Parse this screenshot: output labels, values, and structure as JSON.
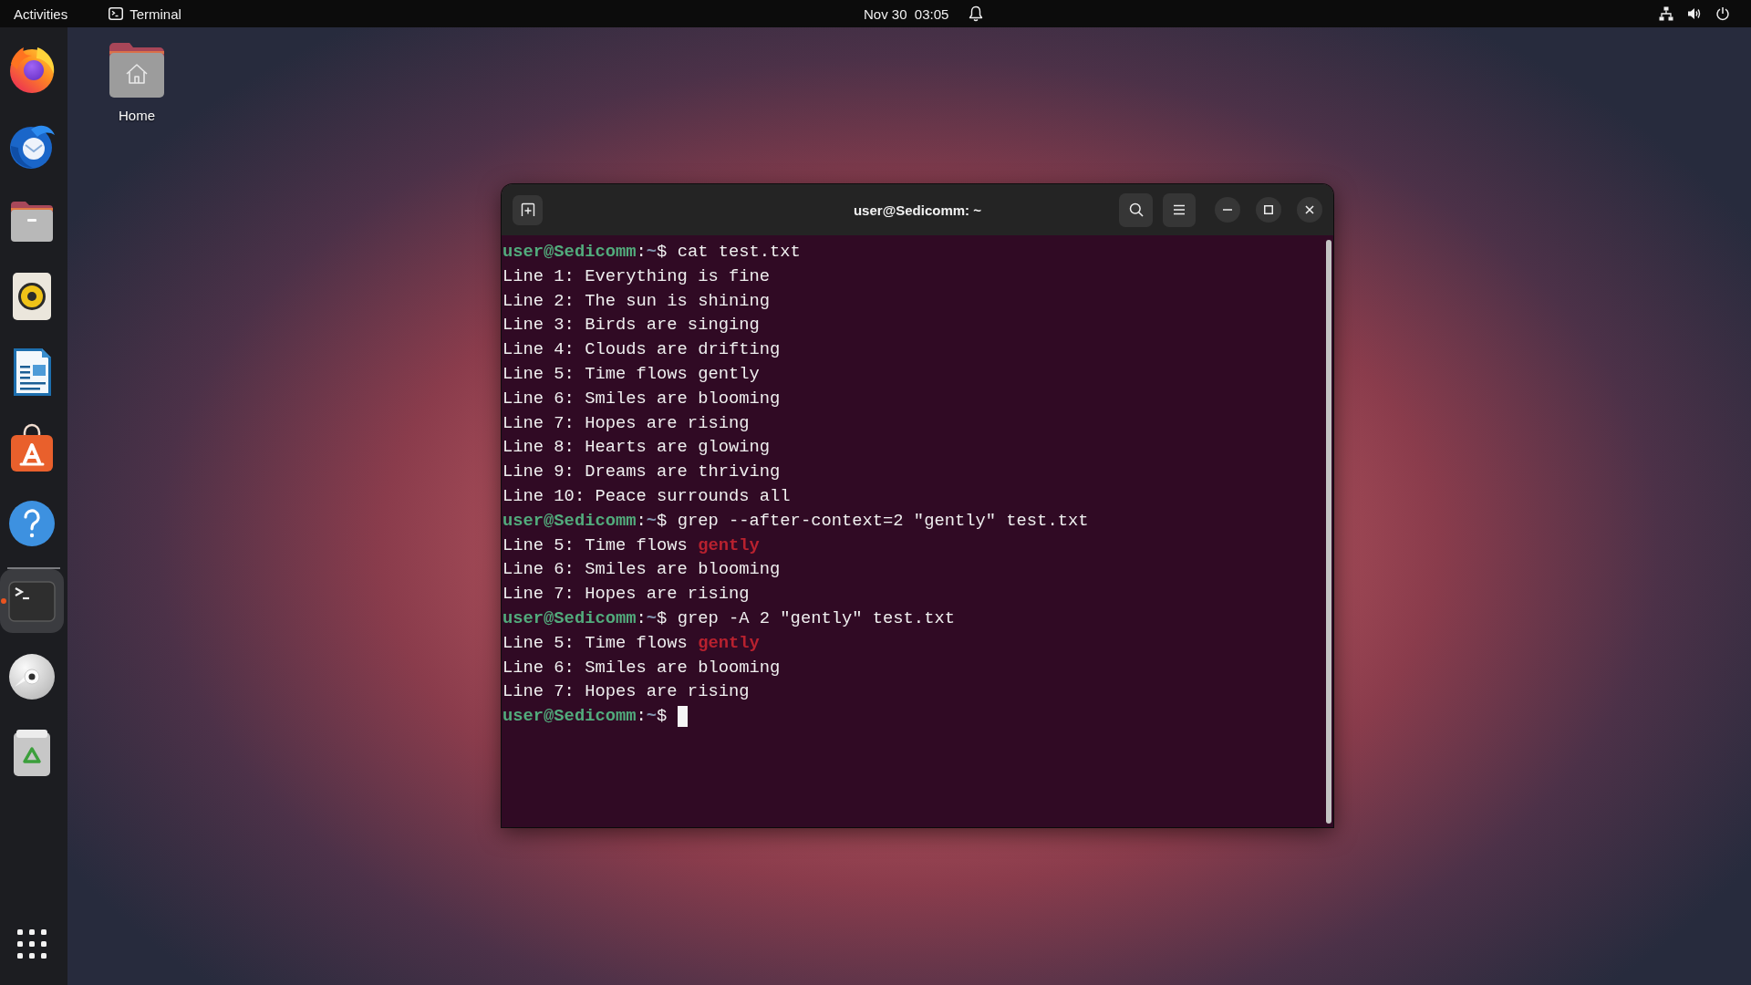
{
  "top_bar": {
    "activities": "Activities",
    "app_menu": "Terminal",
    "clock": "Nov 30  03:05"
  },
  "dock": {
    "pinned": [
      {
        "kind": "browser",
        "running": false
      },
      {
        "kind": "mail",
        "running": false
      },
      {
        "kind": "files",
        "running": false
      },
      {
        "kind": "music",
        "running": false
      },
      {
        "kind": "writer",
        "running": false
      },
      {
        "kind": "store",
        "running": false
      },
      {
        "kind": "help",
        "running": false
      }
    ],
    "others": [
      {
        "kind": "terminal",
        "running": true
      },
      {
        "kind": "disc",
        "running": false
      },
      {
        "kind": "trash",
        "running": false
      }
    ]
  },
  "desktop_icons": [
    {
      "label": "Home"
    }
  ],
  "terminal": {
    "title": "user@Sedicomm: ~",
    "lines": [
      {
        "segments": [
          {
            "kind": "user",
            "text": "user@Sedicomm"
          },
          {
            "kind": "plain",
            "text": ":"
          },
          {
            "kind": "path",
            "text": "~"
          },
          {
            "kind": "plain",
            "text": "$ cat test.txt"
          }
        ]
      },
      {
        "segments": [
          {
            "kind": "plain",
            "text": "Line 1: Everything is fine"
          }
        ]
      },
      {
        "segments": [
          {
            "kind": "plain",
            "text": "Line 2: The sun is shining"
          }
        ]
      },
      {
        "segments": [
          {
            "kind": "plain",
            "text": "Line 3: Birds are singing"
          }
        ]
      },
      {
        "segments": [
          {
            "kind": "plain",
            "text": "Line 4: Clouds are drifting"
          }
        ]
      },
      {
        "segments": [
          {
            "kind": "plain",
            "text": "Line 5: Time flows gently"
          }
        ]
      },
      {
        "segments": [
          {
            "kind": "plain",
            "text": "Line 6: Smiles are blooming"
          }
        ]
      },
      {
        "segments": [
          {
            "kind": "plain",
            "text": "Line 7: Hopes are rising"
          }
        ]
      },
      {
        "segments": [
          {
            "kind": "plain",
            "text": "Line 8: Hearts are glowing"
          }
        ]
      },
      {
        "segments": [
          {
            "kind": "plain",
            "text": "Line 9: Dreams are thriving"
          }
        ]
      },
      {
        "segments": [
          {
            "kind": "plain",
            "text": "Line 10: Peace surrounds all"
          }
        ]
      },
      {
        "segments": [
          {
            "kind": "user",
            "text": "user@Sedicomm"
          },
          {
            "kind": "plain",
            "text": ":"
          },
          {
            "kind": "path",
            "text": "~"
          },
          {
            "kind": "plain",
            "text": "$ grep --after-context=2 \"gently\" test.txt"
          }
        ]
      },
      {
        "segments": [
          {
            "kind": "plain",
            "text": "Line 5: Time flows "
          },
          {
            "kind": "match",
            "text": "gently"
          }
        ]
      },
      {
        "segments": [
          {
            "kind": "plain",
            "text": "Line 6: Smiles are blooming"
          }
        ]
      },
      {
        "segments": [
          {
            "kind": "plain",
            "text": "Line 7: Hopes are rising"
          }
        ]
      },
      {
        "segments": [
          {
            "kind": "user",
            "text": "user@Sedicomm"
          },
          {
            "kind": "plain",
            "text": ":"
          },
          {
            "kind": "path",
            "text": "~"
          },
          {
            "kind": "plain",
            "text": "$ grep -A 2 \"gently\" test.txt"
          }
        ]
      },
      {
        "segments": [
          {
            "kind": "plain",
            "text": "Line 5: Time flows "
          },
          {
            "kind": "match",
            "text": "gently"
          }
        ]
      },
      {
        "segments": [
          {
            "kind": "plain",
            "text": "Line 6: Smiles are blooming"
          }
        ]
      },
      {
        "segments": [
          {
            "kind": "plain",
            "text": "Line 7: Hopes are rising"
          }
        ]
      },
      {
        "segments": [
          {
            "kind": "user",
            "text": "user@Sedicomm"
          },
          {
            "kind": "plain",
            "text": ":"
          },
          {
            "kind": "path",
            "text": "~"
          },
          {
            "kind": "plain",
            "text": "$"
          }
        ]
      }
    ],
    "cursor_visible": true
  }
}
